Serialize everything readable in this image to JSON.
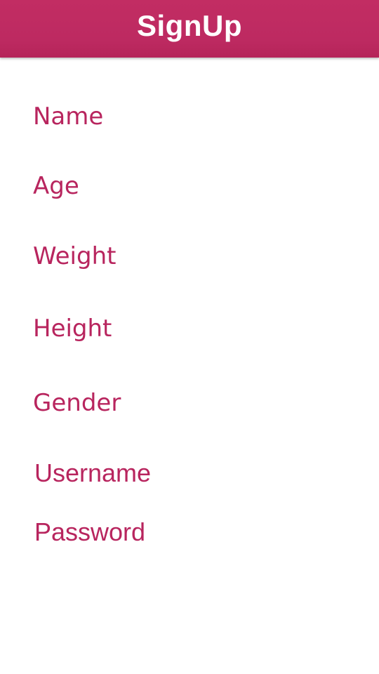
{
  "header": {
    "title": "SignUp",
    "background_color": "#c22d63"
  },
  "form": {
    "label_color": "#b8255e",
    "fields": {
      "name": {
        "label": "Name"
      },
      "age": {
        "label": "Age"
      },
      "weight": {
        "label": "Weight"
      },
      "height": {
        "label": "Height"
      },
      "gender": {
        "label": "Gender"
      },
      "username": {
        "label": "Username"
      },
      "password": {
        "label": "Password"
      }
    }
  }
}
